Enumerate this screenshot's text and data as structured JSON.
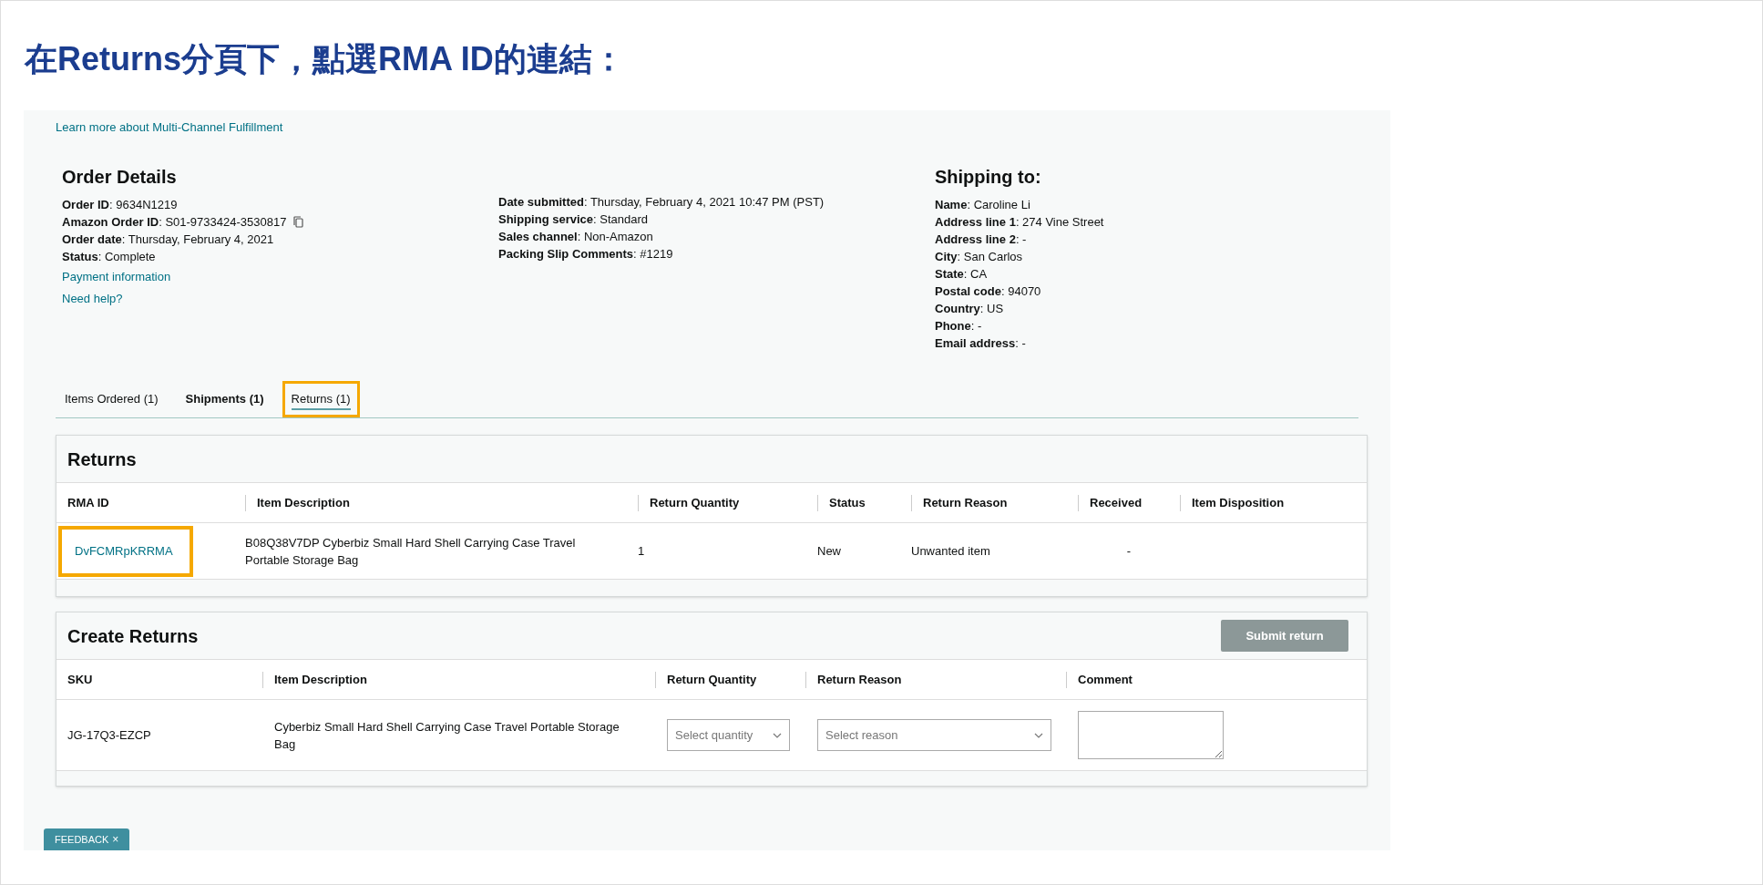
{
  "heading": "在Returns分頁下，點選RMA ID的連結：",
  "learn_more_link": "Learn more about Multi-Channel Fulfillment",
  "order_details": {
    "title": "Order Details",
    "fields": [
      {
        "text": "**Order ID**: 9634N1219",
        "copyable": false
      },
      {
        "text": "**Amazon Order ID**: S01-9733424-3530817",
        "copyable": true
      },
      {
        "text": "**Order date**: Thursday, February 4, 2021",
        "copyable": false
      },
      {
        "text": "**Status**: Complete",
        "copyable": false
      }
    ],
    "links": [
      "Payment information",
      "Need help?"
    ],
    "fields_2": [
      "**Date submitted**: Thursday, February 4, 2021 10:47 PM (PST)",
      "**Shipping service**: Standard",
      "**Sales channel**: Non-Amazon",
      "**Packing Slip Comments**: #1219"
    ]
  },
  "shipping_to": {
    "title": "Shipping to:",
    "fields": [
      "**Name**: Caroline Li",
      "**Address line 1**: 274 Vine Street",
      "**Address line 2**: -",
      "**City**: San Carlos",
      "**State**: CA",
      "**Postal code**: 94070",
      "**Country**: US",
      "**Phone**: -",
      "**Email address**: -"
    ]
  },
  "tabs": [
    {
      "label": "Items Ordered (1)",
      "selected": false,
      "bold": false,
      "highlighted": false
    },
    {
      "label": "Shipments (1)",
      "selected": false,
      "bold": true,
      "highlighted": false
    },
    {
      "label": "Returns (1)",
      "selected": true,
      "bold": false,
      "highlighted": true
    }
  ],
  "returns": {
    "title": "Returns",
    "columns": [
      "RMA ID",
      "Item Description",
      "Return Quantity",
      "Status",
      "Return Reason",
      "Received",
      "Item Disposition"
    ],
    "rows": [
      {
        "rma_id": "DvFCMRpKRRMA",
        "rma_highlighted": true,
        "item_description": "B08Q38V7DP Cyberbiz Small Hard Shell Carrying Case Travel Portable Storage Bag",
        "return_quantity": "1",
        "status": "New",
        "return_reason": "Unwanted item",
        "received": "-"
      }
    ]
  },
  "create_returns": {
    "title": "Create Returns",
    "submit_button": "Submit return",
    "columns": [
      "SKU",
      "Item Description",
      "Return Quantity",
      "Return Reason",
      "Comment"
    ],
    "rows": [
      {
        "sku": "JG-17Q3-EZCP",
        "item_description": "Cyberbiz Small Hard Shell Carrying Case Travel Portable Storage Bag",
        "quantity_placeholder": "Select quantity",
        "reason_placeholder": "Select reason"
      }
    ]
  },
  "feedback_tab": {
    "label": "FEEDBACK",
    "close": "×"
  }
}
